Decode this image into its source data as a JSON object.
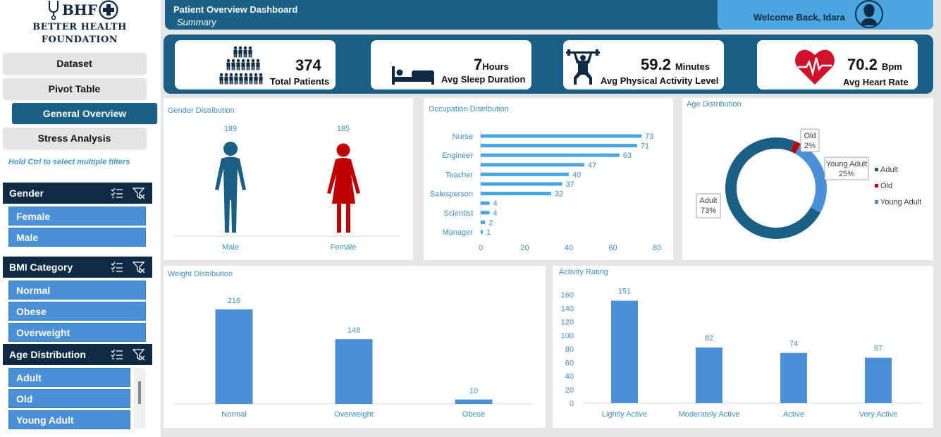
{
  "logo": {
    "abbr": "BHF",
    "line1": "BETTER HEALTH",
    "line2": "FOUNDATION"
  },
  "nav": {
    "dataset": "Dataset",
    "pivot": "Pivot Table",
    "overview": "General Overview",
    "stress": "Stress Analysis"
  },
  "hint": "Hold Ctrl to select multiple filters",
  "slicers": {
    "gender": {
      "title": "Gender",
      "items": [
        "Female",
        "Male"
      ]
    },
    "bmi": {
      "title": "BMI Category",
      "items": [
        "Normal",
        "Obese",
        "Overweight"
      ]
    },
    "age": {
      "title": "Age Distribution",
      "items": [
        "Adult",
        "Old",
        "Young Adult"
      ]
    }
  },
  "header": {
    "title": "Patient Overview Dashboard",
    "subtitle": "Summary",
    "welcome": "Welcome Back, Idara"
  },
  "kpis": {
    "patients": {
      "value": "374",
      "label": "Total Patients"
    },
    "sleep": {
      "value": "7",
      "unit": "Hours",
      "label": "Avg Sleep Duration"
    },
    "activity": {
      "value": "59.2",
      "unit": "Minutes",
      "label": "Avg Physical Activity Level"
    },
    "heart": {
      "value": "70.2",
      "unit": "Bpm",
      "label": "Avg Heart Rate"
    }
  },
  "colors": {
    "navy": "#0f2a44",
    "teal": "#1a5f86",
    "blue": "#4a90d9",
    "light_blue": "#4aa6de",
    "red": "#c00000",
    "chart_text": "#3e8fd0"
  },
  "chart_data": [
    {
      "type": "bar",
      "title": "Gender Distribution",
      "categories": [
        "Male",
        "Female"
      ],
      "values": [
        189,
        185
      ]
    },
    {
      "type": "bar",
      "orientation": "horizontal",
      "title": "Occupation Distribution",
      "categories": [
        "Nurse",
        "",
        "Engineer",
        "",
        "Teacher",
        "",
        "Salesperson",
        "",
        "Scientist",
        "",
        "Manager"
      ],
      "values": [
        73,
        71,
        63,
        47,
        40,
        37,
        32,
        4,
        4,
        2,
        1
      ],
      "xlim": [
        0,
        80
      ],
      "xticks": [
        0,
        20,
        40,
        60,
        80
      ]
    },
    {
      "type": "pie",
      "title": "Age Distribution",
      "categories": [
        "Adult",
        "Old",
        "Young Adult"
      ],
      "values": [
        73,
        2,
        25
      ],
      "labels": [
        "73%",
        "2%",
        "25%"
      ],
      "colors": [
        "#1a5f86",
        "#c00000",
        "#4a90d9"
      ],
      "legend": "right"
    },
    {
      "type": "bar",
      "title": "Weight Distribution",
      "categories": [
        "Normal",
        "Overweight",
        "Obese"
      ],
      "values": [
        216,
        148,
        10
      ]
    },
    {
      "type": "bar",
      "title": "Activity Rating",
      "categories": [
        "Lightly Active",
        "Moderately Active",
        "Active",
        "Very Active"
      ],
      "values": [
        151,
        82,
        74,
        67
      ],
      "ylim": [
        0,
        160
      ],
      "yticks": [
        0,
        20,
        40,
        60,
        80,
        100,
        120,
        140,
        160
      ]
    }
  ]
}
